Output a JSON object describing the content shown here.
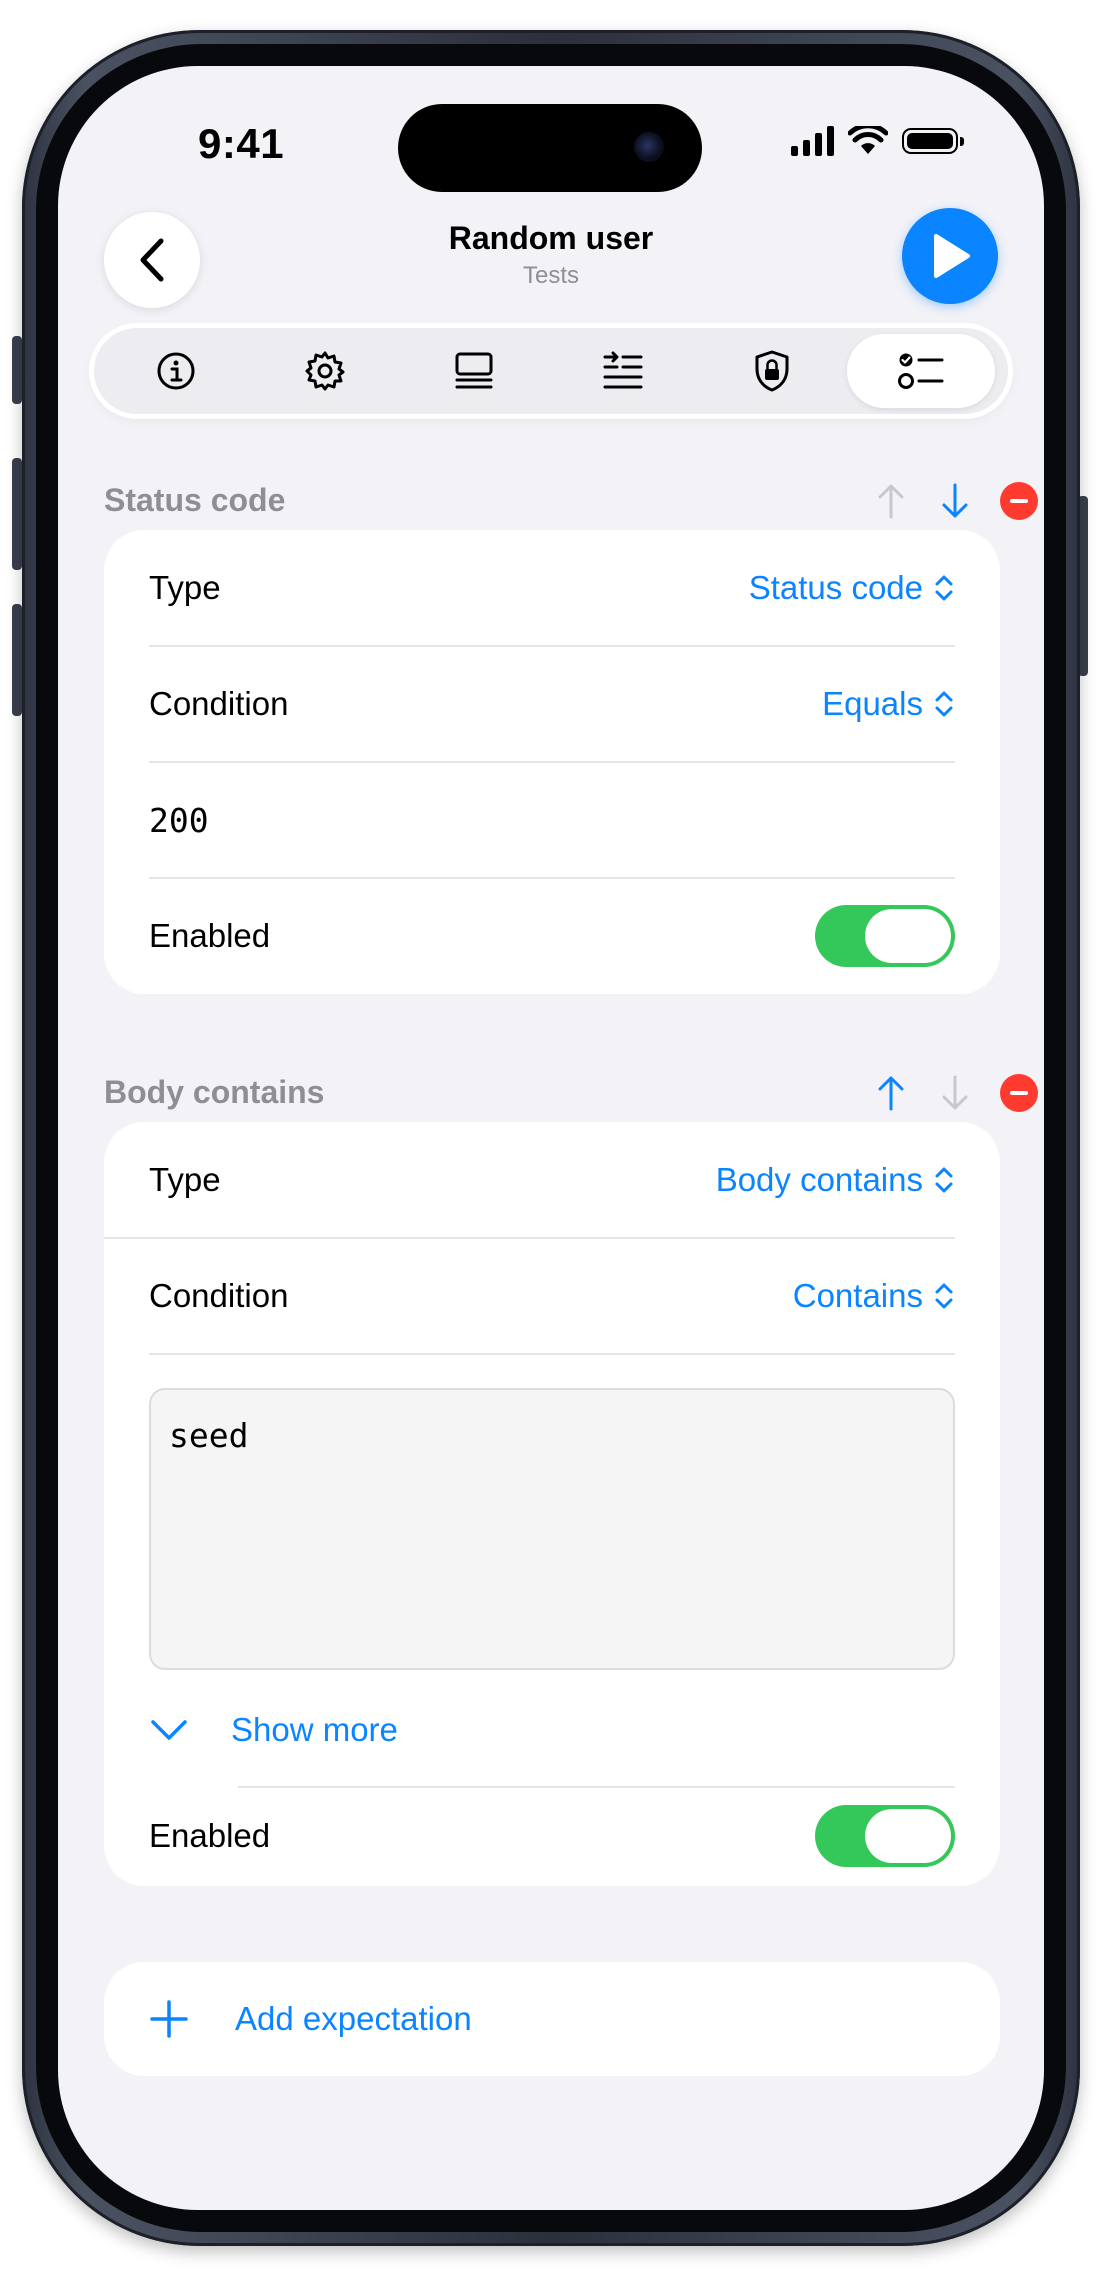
{
  "status_bar": {
    "time": "9:41"
  },
  "nav": {
    "title": "Random user",
    "subtitle": "Tests"
  },
  "tabs": [
    {
      "icon": "info-icon"
    },
    {
      "icon": "gear-icon"
    },
    {
      "icon": "body-icon"
    },
    {
      "icon": "headers-icon"
    },
    {
      "icon": "lock-shield-icon"
    },
    {
      "icon": "checklist-icon",
      "active": true
    }
  ],
  "expectations": [
    {
      "header": "Status code",
      "type_label": "Type",
      "type_value": "Status code",
      "condition_label": "Condition",
      "condition_value": "Equals",
      "value": "200",
      "enabled_label": "Enabled",
      "enabled": true
    },
    {
      "header": "Body contains",
      "type_label": "Type",
      "type_value": "Body contains",
      "condition_label": "Condition",
      "condition_value": "Contains",
      "value": "seed",
      "show_more": "Show more",
      "enabled_label": "Enabled",
      "enabled": true
    }
  ],
  "add_expectation": "Add expectation",
  "colors": {
    "accent": "#0a84ff",
    "toggle_on": "#34c759",
    "destructive": "#ff3b30",
    "background": "#f2f2f7"
  }
}
